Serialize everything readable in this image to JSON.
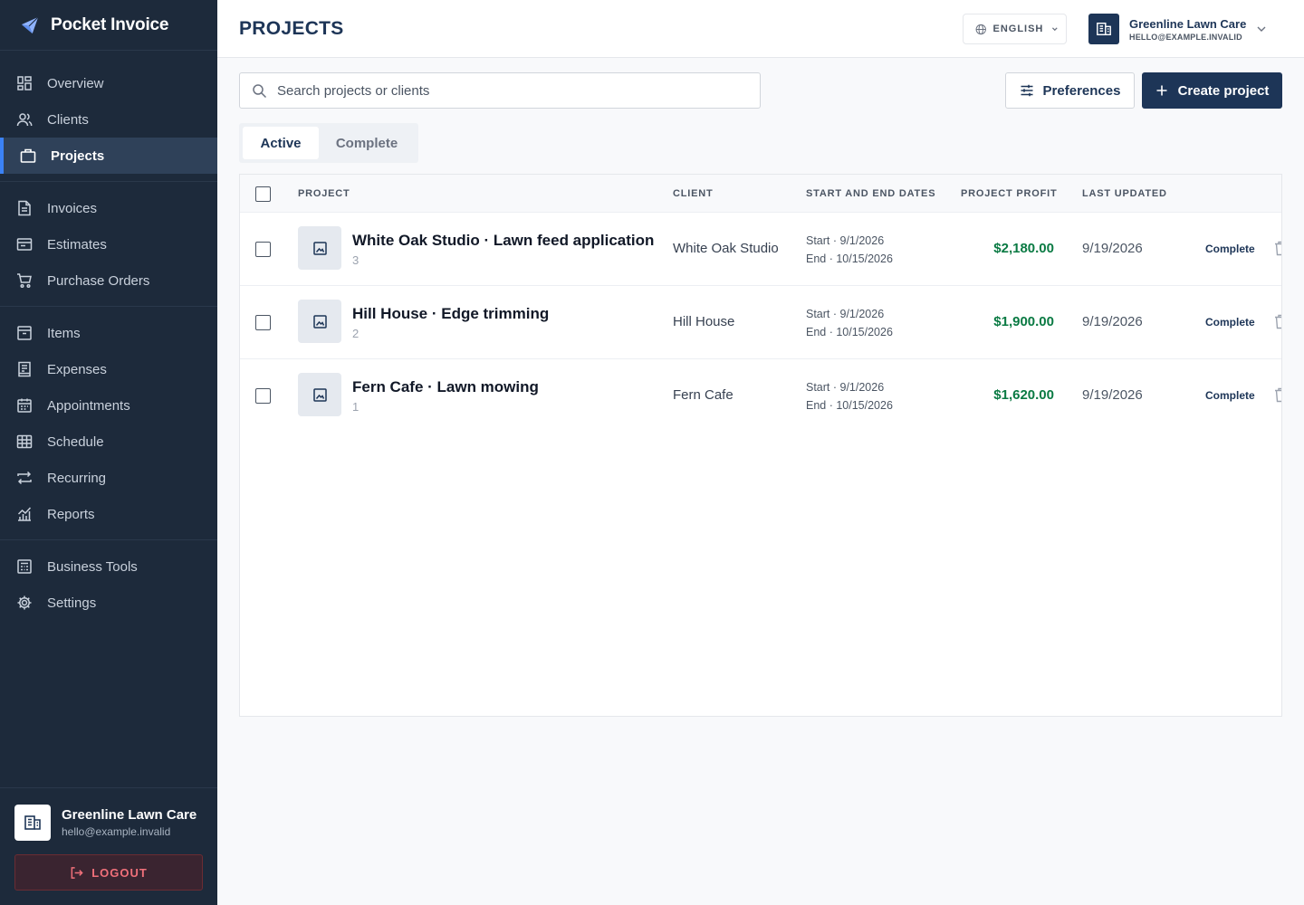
{
  "app": {
    "name": "Pocket Invoice"
  },
  "sidebar": {
    "groups": [
      [
        {
          "label": "Overview",
          "icon": "grid-icon"
        },
        {
          "label": "Clients",
          "icon": "users-icon"
        },
        {
          "label": "Projects",
          "icon": "briefcase-icon",
          "active": true
        }
      ],
      [
        {
          "label": "Invoices",
          "icon": "document-icon"
        },
        {
          "label": "Estimates",
          "icon": "folder-icon"
        },
        {
          "label": "Purchase Orders",
          "icon": "cart-icon"
        }
      ],
      [
        {
          "label": "Items",
          "icon": "box-icon"
        },
        {
          "label": "Expenses",
          "icon": "receipt-icon"
        },
        {
          "label": "Appointments",
          "icon": "calendar-icon"
        },
        {
          "label": "Schedule",
          "icon": "table-icon"
        },
        {
          "label": "Recurring",
          "icon": "repeat-icon"
        },
        {
          "label": "Reports",
          "icon": "chart-icon"
        }
      ],
      [
        {
          "label": "Business Tools",
          "icon": "calculator-icon"
        },
        {
          "label": "Settings",
          "icon": "gear-icon"
        }
      ]
    ],
    "account": {
      "name": "Greenline Lawn Care",
      "email": "hello@example.invalid"
    },
    "logout_label": "LOGOUT"
  },
  "header": {
    "title": "PROJECTS",
    "language": "ENGLISH",
    "account_name": "Greenline Lawn Care",
    "account_email": "HELLO@EXAMPLE.INVALID"
  },
  "toolbar": {
    "search_placeholder": "Search projects or clients",
    "search_value": "",
    "preferences_label": "Preferences",
    "create_label": "Create project"
  },
  "tabs": [
    {
      "label": "Active",
      "active": true
    },
    {
      "label": "Complete",
      "active": false
    }
  ],
  "table": {
    "columns": {
      "project": "PROJECT",
      "client": "CLIENT",
      "dates": "START AND END DATES",
      "profit": "PROJECT PROFIT",
      "updated": "LAST UPDATED"
    },
    "rows": [
      {
        "name": "White Oak Studio · Lawn feed application",
        "count": "3",
        "client": "White Oak Studio",
        "start": "Start · 9/1/2026",
        "end": "End · 10/15/2026",
        "profit": "$2,180.00",
        "updated": "9/19/2026",
        "action": "Complete"
      },
      {
        "name": "Hill House · Edge trimming",
        "count": "2",
        "client": "Hill House",
        "start": "Start · 9/1/2026",
        "end": "End · 10/15/2026",
        "profit": "$1,900.00",
        "updated": "9/19/2026",
        "action": "Complete"
      },
      {
        "name": "Fern Cafe · Lawn mowing",
        "count": "1",
        "client": "Fern Cafe",
        "start": "Start · 9/1/2026",
        "end": "End · 10/15/2026",
        "profit": "$1,620.00",
        "updated": "9/19/2026",
        "action": "Complete"
      }
    ]
  },
  "colors": {
    "sidebar_bg": "#1d2a3b",
    "primary": "#1d3557",
    "accent": "#3b82f6",
    "profit_green": "#0a7a43",
    "logout_red": "#f0707a"
  }
}
